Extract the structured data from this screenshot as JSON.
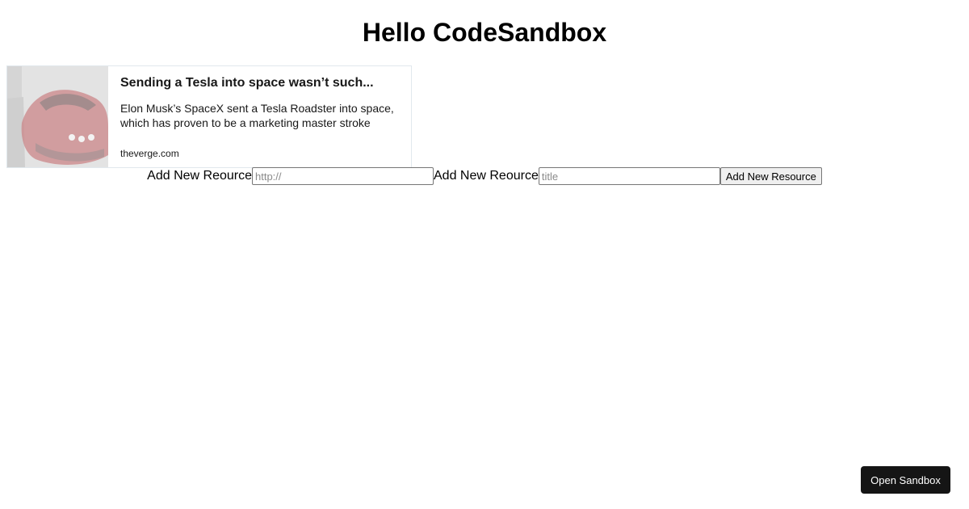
{
  "page": {
    "title": "Hello CodeSandbox"
  },
  "link_card": {
    "title": "Sending a Tesla into space wasn’t such...",
    "description": "Elon Musk’s SpaceX sent a Tesla Roadster into space, which has proven to be a marketing master stroke",
    "domain": "theverge.com",
    "image_icon": "tesla-roadster-image"
  },
  "form": {
    "url_label": "Add New Reource",
    "url_placeholder": "http://",
    "url_value": "",
    "title_label": "Add New Reource",
    "title_placeholder": "title",
    "title_value": "",
    "submit_label": "Add New Resource"
  },
  "open_sandbox": {
    "label": "Open Sandbox"
  },
  "colors": {
    "open_sandbox_bg": "#151515",
    "card_border": "#e1e8ed",
    "car_red": "#b0454a"
  }
}
